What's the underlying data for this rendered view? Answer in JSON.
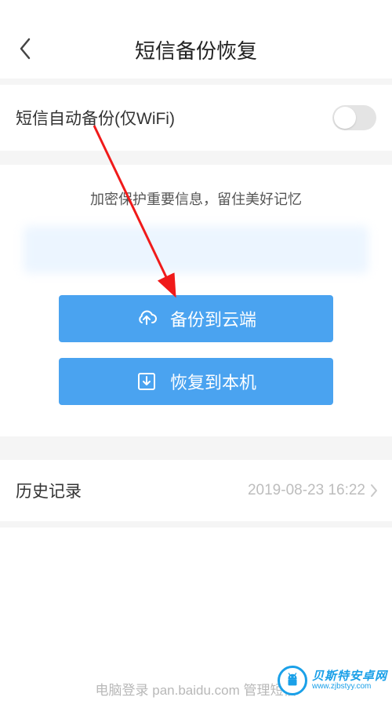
{
  "header": {
    "title": "短信备份恢复"
  },
  "autoBackup": {
    "label": "短信自动备份(仅WiFi)",
    "enabled": false
  },
  "promo": {
    "text": "加密保护重要信息，留住美好记忆"
  },
  "buttons": {
    "backup": "备份到云端",
    "restore": "恢复到本机"
  },
  "history": {
    "label": "历史记录",
    "timestamp": "2019-08-23 16:22"
  },
  "footer": {
    "tip": "电脑登录 pan.baidu.com 管理短信"
  },
  "watermark": {
    "line1": "贝斯特安卓网",
    "line2": "www.zjbstyy.com"
  },
  "colors": {
    "primaryBlue": "#4aa3f0",
    "watermarkBlue": "#1aa0e8",
    "annotationRed": "#f01a1a"
  }
}
